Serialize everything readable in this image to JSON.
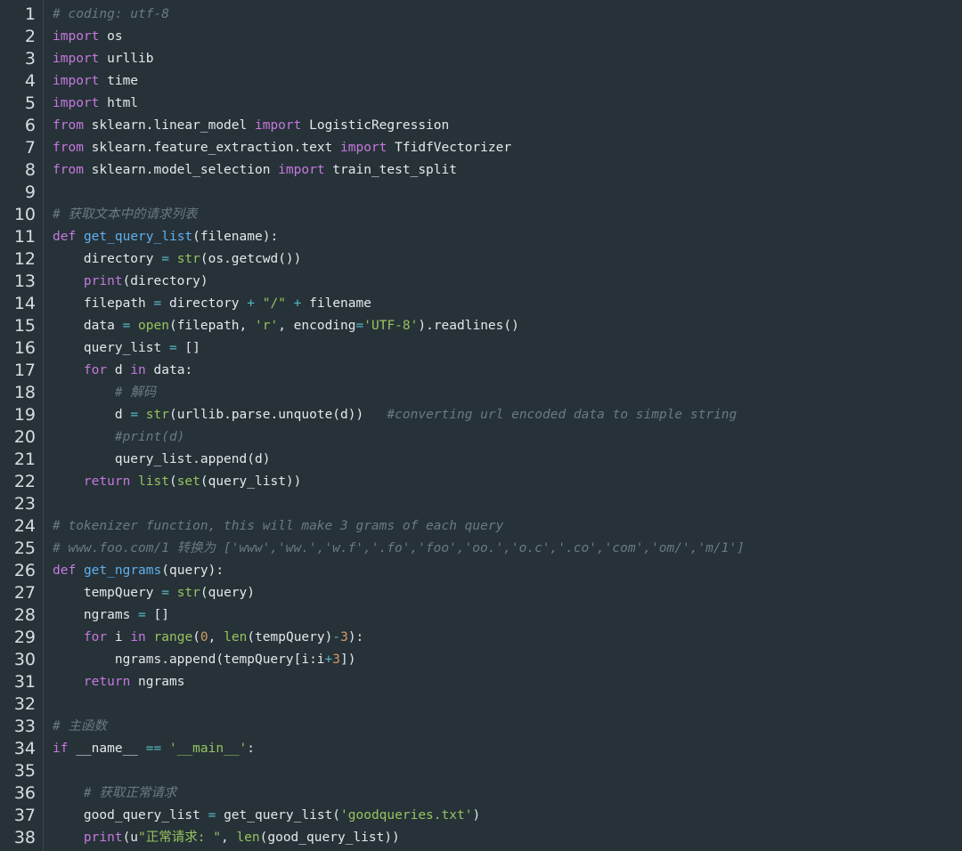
{
  "editor": {
    "language": "python",
    "colors": {
      "background": "#263238",
      "keyword": "#c678dd",
      "function": "#61afef",
      "builtin": "#98c35e",
      "string": "#98c35e",
      "operator": "#56b6c2",
      "number": "#d19a66",
      "comment": "#6a7a82",
      "text": "#e4e8ea"
    },
    "lines": [
      {
        "n": "1",
        "tokens": [
          {
            "t": "cm",
            "v": "# coding: utf-8"
          }
        ]
      },
      {
        "n": "2",
        "tokens": [
          {
            "t": "kw",
            "v": "import"
          },
          {
            "t": "tx",
            "v": " os"
          }
        ]
      },
      {
        "n": "3",
        "tokens": [
          {
            "t": "kw",
            "v": "import"
          },
          {
            "t": "tx",
            "v": " urllib"
          }
        ]
      },
      {
        "n": "4",
        "tokens": [
          {
            "t": "kw",
            "v": "import"
          },
          {
            "t": "tx",
            "v": " time"
          }
        ]
      },
      {
        "n": "5",
        "tokens": [
          {
            "t": "kw",
            "v": "import"
          },
          {
            "t": "tx",
            "v": " html"
          }
        ]
      },
      {
        "n": "6",
        "tokens": [
          {
            "t": "kw",
            "v": "from"
          },
          {
            "t": "tx",
            "v": " sklearn.linear_model "
          },
          {
            "t": "kw",
            "v": "import"
          },
          {
            "t": "tx",
            "v": " LogisticRegression"
          }
        ]
      },
      {
        "n": "7",
        "tokens": [
          {
            "t": "kw",
            "v": "from"
          },
          {
            "t": "tx",
            "v": " sklearn.feature_extraction.text "
          },
          {
            "t": "kw",
            "v": "import"
          },
          {
            "t": "tx",
            "v": " TfidfVectorizer"
          }
        ]
      },
      {
        "n": "8",
        "tokens": [
          {
            "t": "kw",
            "v": "from"
          },
          {
            "t": "tx",
            "v": " sklearn.model_selection "
          },
          {
            "t": "kw",
            "v": "import"
          },
          {
            "t": "tx",
            "v": " train_test_split"
          }
        ]
      },
      {
        "n": "9",
        "tokens": []
      },
      {
        "n": "10",
        "tokens": [
          {
            "t": "cm",
            "v": "# 获取文本中的请求列表"
          }
        ]
      },
      {
        "n": "11",
        "tokens": [
          {
            "t": "kw",
            "v": "def"
          },
          {
            "t": "tx",
            "v": " "
          },
          {
            "t": "fn",
            "v": "get_query_list"
          },
          {
            "t": "tx",
            "v": "(filename):"
          }
        ]
      },
      {
        "n": "12",
        "tokens": [
          {
            "t": "tx",
            "v": "    directory "
          },
          {
            "t": "op",
            "v": "="
          },
          {
            "t": "tx",
            "v": " "
          },
          {
            "t": "bi",
            "v": "str"
          },
          {
            "t": "tx",
            "v": "(os.getcwd())"
          }
        ]
      },
      {
        "n": "13",
        "tokens": [
          {
            "t": "tx",
            "v": "    "
          },
          {
            "t": "kw",
            "v": "print"
          },
          {
            "t": "tx",
            "v": "(directory)"
          }
        ]
      },
      {
        "n": "14",
        "tokens": [
          {
            "t": "tx",
            "v": "    filepath "
          },
          {
            "t": "op",
            "v": "="
          },
          {
            "t": "tx",
            "v": " directory "
          },
          {
            "t": "op",
            "v": "+"
          },
          {
            "t": "tx",
            "v": " "
          },
          {
            "t": "str",
            "v": "\"/\""
          },
          {
            "t": "tx",
            "v": " "
          },
          {
            "t": "op",
            "v": "+"
          },
          {
            "t": "tx",
            "v": " filename"
          }
        ]
      },
      {
        "n": "15",
        "tokens": [
          {
            "t": "tx",
            "v": "    data "
          },
          {
            "t": "op",
            "v": "="
          },
          {
            "t": "tx",
            "v": " "
          },
          {
            "t": "bi",
            "v": "open"
          },
          {
            "t": "tx",
            "v": "(filepath, "
          },
          {
            "t": "str",
            "v": "'r'"
          },
          {
            "t": "tx",
            "v": ", encoding"
          },
          {
            "t": "op",
            "v": "="
          },
          {
            "t": "str",
            "v": "'UTF-8'"
          },
          {
            "t": "tx",
            "v": ").readlines()"
          }
        ]
      },
      {
        "n": "16",
        "tokens": [
          {
            "t": "tx",
            "v": "    query_list "
          },
          {
            "t": "op",
            "v": "="
          },
          {
            "t": "tx",
            "v": " []"
          }
        ]
      },
      {
        "n": "17",
        "tokens": [
          {
            "t": "tx",
            "v": "    "
          },
          {
            "t": "kw",
            "v": "for"
          },
          {
            "t": "tx",
            "v": " d "
          },
          {
            "t": "kw",
            "v": "in"
          },
          {
            "t": "tx",
            "v": " data:"
          }
        ]
      },
      {
        "n": "18",
        "tokens": [
          {
            "t": "tx",
            "v": "        "
          },
          {
            "t": "cm",
            "v": "# 解码"
          }
        ]
      },
      {
        "n": "19",
        "tokens": [
          {
            "t": "tx",
            "v": "        d "
          },
          {
            "t": "op",
            "v": "="
          },
          {
            "t": "tx",
            "v": " "
          },
          {
            "t": "bi",
            "v": "str"
          },
          {
            "t": "tx",
            "v": "(urllib.parse.unquote(d))   "
          },
          {
            "t": "cm",
            "v": "#converting url encoded data to simple string"
          }
        ]
      },
      {
        "n": "20",
        "tokens": [
          {
            "t": "tx",
            "v": "        "
          },
          {
            "t": "cm",
            "v": "#print(d)"
          }
        ]
      },
      {
        "n": "21",
        "tokens": [
          {
            "t": "tx",
            "v": "        query_list.append(d)"
          }
        ]
      },
      {
        "n": "22",
        "tokens": [
          {
            "t": "tx",
            "v": "    "
          },
          {
            "t": "kw",
            "v": "return"
          },
          {
            "t": "tx",
            "v": " "
          },
          {
            "t": "bi",
            "v": "list"
          },
          {
            "t": "tx",
            "v": "("
          },
          {
            "t": "bi",
            "v": "set"
          },
          {
            "t": "tx",
            "v": "(query_list))"
          }
        ]
      },
      {
        "n": "23",
        "tokens": []
      },
      {
        "n": "24",
        "tokens": [
          {
            "t": "cm",
            "v": "# tokenizer function, this will make 3 grams of each query"
          }
        ]
      },
      {
        "n": "25",
        "tokens": [
          {
            "t": "cm",
            "v": "# www.foo.com/1 转换为 ['www','ww.','w.f','.fo','foo','oo.','o.c','.co','com','om/','m/1']"
          }
        ]
      },
      {
        "n": "26",
        "tokens": [
          {
            "t": "kw",
            "v": "def"
          },
          {
            "t": "tx",
            "v": " "
          },
          {
            "t": "fn",
            "v": "get_ngrams"
          },
          {
            "t": "tx",
            "v": "(query):"
          }
        ]
      },
      {
        "n": "27",
        "tokens": [
          {
            "t": "tx",
            "v": "    tempQuery "
          },
          {
            "t": "op",
            "v": "="
          },
          {
            "t": "tx",
            "v": " "
          },
          {
            "t": "bi",
            "v": "str"
          },
          {
            "t": "tx",
            "v": "(query)"
          }
        ]
      },
      {
        "n": "28",
        "tokens": [
          {
            "t": "tx",
            "v": "    ngrams "
          },
          {
            "t": "op",
            "v": "="
          },
          {
            "t": "tx",
            "v": " []"
          }
        ]
      },
      {
        "n": "29",
        "tokens": [
          {
            "t": "tx",
            "v": "    "
          },
          {
            "t": "kw",
            "v": "for"
          },
          {
            "t": "tx",
            "v": " i "
          },
          {
            "t": "kw",
            "v": "in"
          },
          {
            "t": "tx",
            "v": " "
          },
          {
            "t": "bi",
            "v": "range"
          },
          {
            "t": "tx",
            "v": "("
          },
          {
            "t": "num",
            "v": "0"
          },
          {
            "t": "tx",
            "v": ", "
          },
          {
            "t": "bi",
            "v": "len"
          },
          {
            "t": "tx",
            "v": "(tempQuery)"
          },
          {
            "t": "op",
            "v": "-"
          },
          {
            "t": "num",
            "v": "3"
          },
          {
            "t": "tx",
            "v": "):"
          }
        ]
      },
      {
        "n": "30",
        "tokens": [
          {
            "t": "tx",
            "v": "        ngrams.append(tempQuery[i:i"
          },
          {
            "t": "op",
            "v": "+"
          },
          {
            "t": "num",
            "v": "3"
          },
          {
            "t": "tx",
            "v": "])"
          }
        ]
      },
      {
        "n": "31",
        "tokens": [
          {
            "t": "tx",
            "v": "    "
          },
          {
            "t": "kw",
            "v": "return"
          },
          {
            "t": "tx",
            "v": " ngrams"
          }
        ]
      },
      {
        "n": "32",
        "tokens": []
      },
      {
        "n": "33",
        "tokens": [
          {
            "t": "cm",
            "v": "# 主函数"
          }
        ]
      },
      {
        "n": "34",
        "tokens": [
          {
            "t": "kw",
            "v": "if"
          },
          {
            "t": "tx",
            "v": " __name__ "
          },
          {
            "t": "op",
            "v": "=="
          },
          {
            "t": "tx",
            "v": " "
          },
          {
            "t": "str",
            "v": "'__main__'"
          },
          {
            "t": "tx",
            "v": ":"
          }
        ]
      },
      {
        "n": "35",
        "tokens": []
      },
      {
        "n": "36",
        "tokens": [
          {
            "t": "tx",
            "v": "    "
          },
          {
            "t": "cm",
            "v": "# 获取正常请求"
          }
        ]
      },
      {
        "n": "37",
        "tokens": [
          {
            "t": "tx",
            "v": "    good_query_list "
          },
          {
            "t": "op",
            "v": "="
          },
          {
            "t": "tx",
            "v": " get_query_list("
          },
          {
            "t": "str",
            "v": "'goodqueries.txt'"
          },
          {
            "t": "tx",
            "v": ")"
          }
        ]
      },
      {
        "n": "38",
        "tokens": [
          {
            "t": "tx",
            "v": "    "
          },
          {
            "t": "kw",
            "v": "print"
          },
          {
            "t": "tx",
            "v": "(u"
          },
          {
            "t": "str",
            "v": "\"正常请求: \""
          },
          {
            "t": "tx",
            "v": ", "
          },
          {
            "t": "bi",
            "v": "len"
          },
          {
            "t": "tx",
            "v": "(good_query_list))"
          }
        ]
      }
    ]
  }
}
